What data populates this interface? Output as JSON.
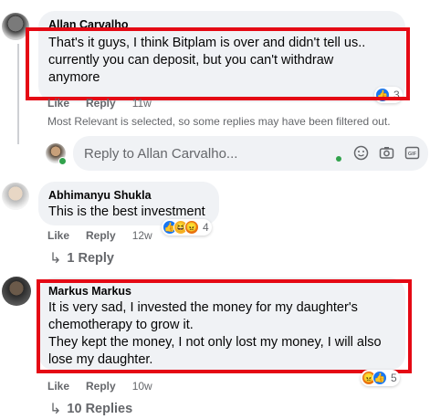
{
  "comments": [
    {
      "author": "Allan Carvalho",
      "text_lines": [
        "That's it guys, I think Bitplam is over and didn't tell us..",
        "currently you can deposit, but you can't withdraw",
        "anymore"
      ],
      "like_label": "Like",
      "reply_label": "Reply",
      "time": "11w",
      "reaction_count": "3",
      "reactions": [
        "like-icon"
      ]
    },
    {
      "author": "Abhimanyu Shukla",
      "text_lines": [
        "This is the best investment"
      ],
      "like_label": "Like",
      "reply_label": "Reply",
      "time": "12w",
      "reaction_count": "4",
      "reactions": [
        "like-icon",
        "haha-icon",
        "angry-icon"
      ],
      "replies_label": "1 Reply"
    },
    {
      "author": "Markus Markus",
      "text_lines": [
        "It is very sad, I invested the money for my daughter's",
        "chemotherapy to grow it.",
        "They kept the money, I not only lost my money, I will also",
        "lose my daughter."
      ],
      "like_label": "Like",
      "reply_label": "Reply",
      "time": "10w",
      "reaction_count": "5",
      "reactions": [
        "angry-icon",
        "like-icon"
      ],
      "replies_label": "10 Replies"
    }
  ],
  "filter_note": "Most Relevant is selected, so some replies may have been filtered out.",
  "reply_input": {
    "placeholder": "Reply to Allan Carvalho...",
    "icons": [
      "emoji-icon",
      "camera-icon",
      "gif-icon",
      "sticker-icon"
    ]
  },
  "colors": {
    "highlight_box": "#e50914",
    "bubble_bg": "#f0f2f5",
    "muted_text": "#65676b",
    "online_dot": "#31a24c"
  }
}
